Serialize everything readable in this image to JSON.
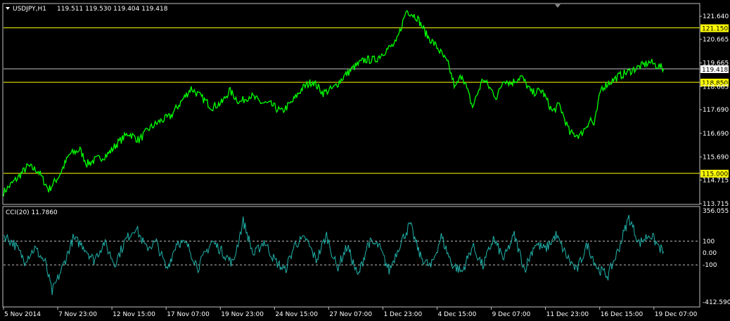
{
  "header": {
    "symbol": "USDJPY,H1",
    "ohlc": "119.511 119.530 119.404 119.418",
    "indicator": "CCI(20) 11.7860"
  },
  "colors": {
    "background": "#000000",
    "price": "#00ff00",
    "cci": "#20b2aa",
    "hlines": "#ffff00",
    "current": "#c0c0c0",
    "frame": "#c0c0c0",
    "level": "#c0c0c0"
  },
  "chart_data": [
    {
      "type": "line",
      "name": "price",
      "ylim": [
        113.715,
        122.15
      ],
      "y_ticks": [
        "121.640",
        "120.665",
        "119.665",
        "118.665",
        "117.690",
        "116.690",
        "115.690",
        "114.715",
        "113.715"
      ],
      "y_tick_values": [
        121.64,
        120.665,
        119.665,
        118.665,
        117.69,
        116.69,
        115.69,
        114.715,
        113.715
      ],
      "horizontal_levels": [
        {
          "label": "121.150",
          "value": 121.15
        },
        {
          "label": "118.850",
          "value": 118.85
        },
        {
          "label": "115.000",
          "value": 115.0
        }
      ],
      "current_price": {
        "label": "119.418",
        "value": 119.418
      },
      "x_ticks": [
        "5 Nov 2014",
        "7 Nov 23:00",
        "12 Nov 15:00",
        "17 Nov 07:00",
        "19 Nov 23:00",
        "24 Nov 15:00",
        "27 Nov 07:00",
        "1 Dec 23:00",
        "4 Dec 15:00",
        "9 Dec 07:00",
        "11 Dec 23:00",
        "16 Dec 15:00",
        "19 Dec 07:00"
      ],
      "x_tick_positions": [
        0,
        0.078,
        0.156,
        0.234,
        0.312,
        0.39,
        0.468,
        0.546,
        0.624,
        0.702,
        0.78,
        0.858,
        0.936
      ],
      "x_range": [
        0,
        1
      ],
      "series": [
        {
          "x": [
            0,
            0.02,
            0.035,
            0.05,
            0.065,
            0.08,
            0.095,
            0.11,
            0.12,
            0.135,
            0.15,
            0.165,
            0.18,
            0.195,
            0.21,
            0.225,
            0.24,
            0.255,
            0.27,
            0.285,
            0.3,
            0.315,
            0.325,
            0.34,
            0.355,
            0.37,
            0.385,
            0.4,
            0.415,
            0.43,
            0.445,
            0.46,
            0.475,
            0.49,
            0.505,
            0.52,
            0.535,
            0.55,
            0.565,
            0.58,
            0.595,
            0.61,
            0.625,
            0.64,
            0.65,
            0.66,
            0.675,
            0.69,
            0.7,
            0.71,
            0.72,
            0.73,
            0.745,
            0.76,
            0.775,
            0.79,
            0.8,
            0.815,
            0.83,
            0.845,
            0.85,
            0.86,
            0.875,
            0.885,
            0.9,
            0.915,
            0.93,
            0.945,
            0.95
          ],
          "values": [
            114.2,
            114.8,
            115.3,
            115.1,
            114.3,
            114.9,
            115.8,
            116.0,
            115.4,
            115.6,
            115.8,
            116.3,
            116.7,
            116.4,
            116.9,
            117.2,
            117.4,
            118.0,
            118.6,
            118.2,
            117.8,
            118.0,
            118.5,
            118.0,
            118.3,
            118.0,
            117.9,
            117.6,
            118.0,
            118.6,
            118.9,
            118.4,
            118.6,
            119.1,
            119.5,
            119.8,
            119.8,
            120.2,
            120.5,
            121.9,
            121.6,
            120.8,
            120.3,
            119.6,
            118.6,
            119.2,
            117.8,
            119.0,
            118.6,
            118.2,
            119.0,
            118.8,
            119.1,
            118.4,
            118.5,
            117.6,
            117.9,
            116.7,
            116.6,
            117.3,
            117.0,
            118.6,
            118.9,
            119.1,
            119.3,
            119.5,
            119.7,
            119.5,
            119.418
          ]
        }
      ]
    },
    {
      "type": "line",
      "name": "CCI(20)",
      "ylim": [
        -412.5903,
        356.055
      ],
      "y_ticks": [
        "356.055",
        "100",
        "0.00",
        "-100",
        "-412.5903"
      ],
      "y_tick_values": [
        356.055,
        100,
        0,
        -100,
        -412.5903
      ],
      "levels": [
        100,
        -100
      ],
      "series": [
        {
          "x": [
            0,
            0.015,
            0.03,
            0.045,
            0.06,
            0.07,
            0.085,
            0.1,
            0.115,
            0.13,
            0.145,
            0.16,
            0.175,
            0.19,
            0.205,
            0.22,
            0.235,
            0.25,
            0.265,
            0.28,
            0.3,
            0.315,
            0.33,
            0.345,
            0.36,
            0.375,
            0.39,
            0.405,
            0.42,
            0.435,
            0.45,
            0.465,
            0.48,
            0.495,
            0.51,
            0.525,
            0.54,
            0.555,
            0.57,
            0.585,
            0.6,
            0.615,
            0.63,
            0.645,
            0.66,
            0.675,
            0.69,
            0.705,
            0.72,
            0.735,
            0.75,
            0.765,
            0.78,
            0.795,
            0.81,
            0.825,
            0.84,
            0.855,
            0.87,
            0.885,
            0.9,
            0.915,
            0.93,
            0.945,
            0.95
          ],
          "values": [
            150,
            80,
            -60,
            40,
            -80,
            -330,
            -120,
            120,
            60,
            -60,
            90,
            -90,
            100,
            220,
            40,
            90,
            -140,
            100,
            60,
            -120,
            100,
            10,
            -90,
            270,
            -20,
            100,
            -60,
            -150,
            80,
            120,
            -60,
            150,
            -130,
            60,
            -200,
            90,
            60,
            -150,
            70,
            240,
            -30,
            -120,
            140,
            -90,
            -160,
            60,
            -110,
            120,
            -50,
            150,
            -140,
            80,
            30,
            150,
            -20,
            -150,
            70,
            -130,
            -190,
            30,
            300,
            80,
            160,
            40,
            11.786
          ]
        }
      ]
    }
  ]
}
